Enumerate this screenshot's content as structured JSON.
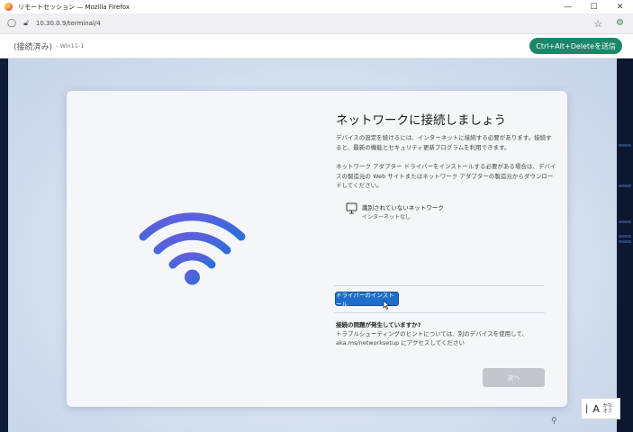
{
  "browser": {
    "window_title": "リモートセッション — Mozilla Firefox",
    "url": "10.30.0.9/terminal/4",
    "controls": {
      "minimize": "—",
      "maximize": "☐",
      "close": "✕"
    }
  },
  "session": {
    "status": "(接続済み)",
    "name": "- Win11-1",
    "cad_button": "Ctrl+Alt+Deleteを送信"
  },
  "oobe": {
    "heading": "ネットワークに接続しましょう",
    "paragraph1": "デバイスの設定を続けるには、インターネットに接続する必要があります。接続すると、最新の機能とセキュリティ更新プログラムを利用できます。",
    "paragraph2": "ネットワーク アダプター ドライバーをインストールする必要がある場合は、デバイスの製造元の Web サイトまたはネットワーク アダプターの製造元からダウンロードしてください。",
    "network": {
      "name": "識別されていないネットワーク",
      "status": "インターネットなし"
    },
    "install_button": "ドライバーのインストール",
    "trouble_heading": "接続の問題が発生していますか?",
    "trouble_text": "トラブルシューティングのヒントについては、別のデバイスを使用して、aka.ms/networksetup にアクセスしてください",
    "next_button": "次へ",
    "accent_color": "#1e6fc9"
  },
  "ime": {
    "clipboard_glyph": "|",
    "mode": "A",
    "mode_label": "かな\nオフ"
  }
}
